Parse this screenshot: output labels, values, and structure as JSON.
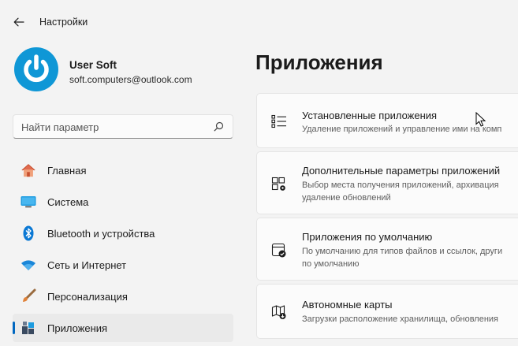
{
  "window": {
    "title": "Настройки"
  },
  "profile": {
    "name": "User Soft",
    "email": "soft.computers@outlook.com"
  },
  "search": {
    "placeholder": "Найти параметр"
  },
  "nav": {
    "items": [
      {
        "label": "Главная",
        "icon": "home-icon"
      },
      {
        "label": "Система",
        "icon": "system-icon"
      },
      {
        "label": "Bluetooth и устройства",
        "icon": "bluetooth-icon"
      },
      {
        "label": "Сеть и Интернет",
        "icon": "wifi-icon"
      },
      {
        "label": "Персонализация",
        "icon": "brush-icon"
      },
      {
        "label": "Приложения",
        "icon": "apps-icon",
        "active": true
      }
    ]
  },
  "main": {
    "title": "Приложения",
    "cards": [
      {
        "title": "Установленные приложения",
        "desc1": "Удаление приложений и управление ими на комп",
        "desc2": "",
        "icon": "list-icon"
      },
      {
        "title": "Дополнительные параметры приложений",
        "desc1": "Выбор места получения приложений, архивация",
        "desc2": "удаление обновлений",
        "icon": "app-settings-icon"
      },
      {
        "title": "Приложения по умолчанию",
        "desc1": "По умолчанию для типов файлов и ссылок, други",
        "desc2": "по умолчанию",
        "icon": "default-apps-icon"
      },
      {
        "title": "Автономные карты",
        "desc1": "Загрузки расположение хранилища, обновления",
        "desc2": "",
        "icon": "map-icon"
      }
    ]
  },
  "colors": {
    "accent": "#0067c0",
    "avatar": "#0f97d6",
    "background": "#f3f3f3"
  }
}
